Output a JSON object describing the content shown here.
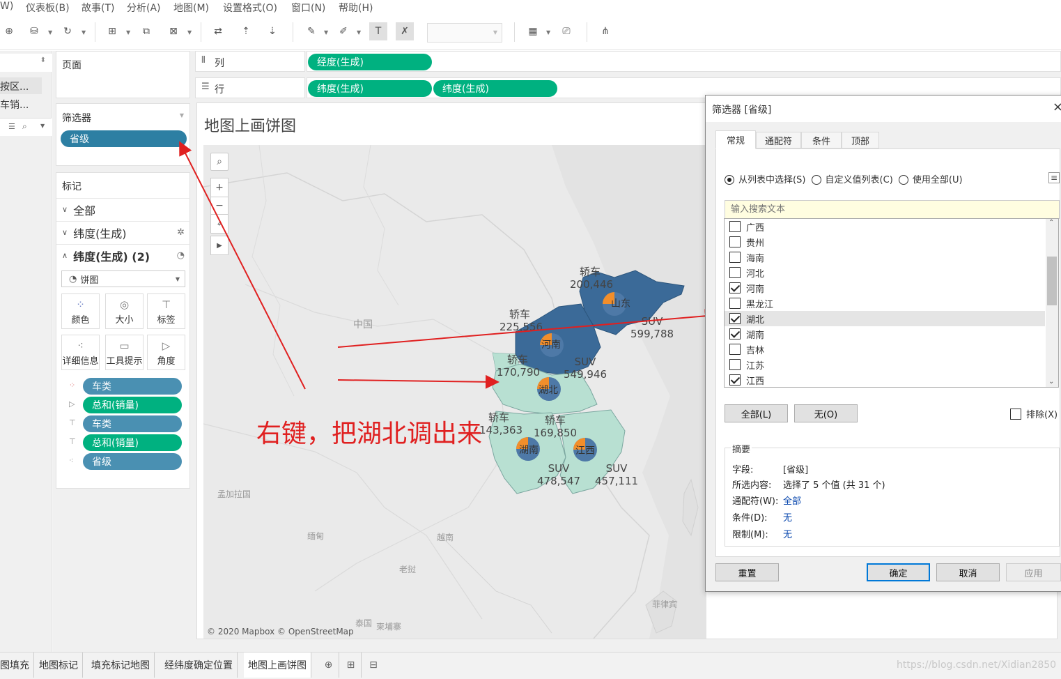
{
  "menu": [
    "W)",
    "仪表板(B)",
    "故事(T)",
    "分析(A)",
    "地图(M)",
    "设置格式(O)",
    "窗口(N)",
    "帮助(H)"
  ],
  "left_panel": {
    "items": [
      "按区...",
      "车销..."
    ]
  },
  "pages_card": {
    "title": "页面"
  },
  "filters_card": {
    "title": "筛选器",
    "pill": "省级"
  },
  "marks_card": {
    "title": "标记",
    "rows": [
      "全部",
      "纬度(生成)",
      "纬度(生成) (2)"
    ],
    "mark_type": "饼图",
    "buttons": [
      "颜色",
      "大小",
      "标签",
      "详细信息",
      "工具提示",
      "角度"
    ],
    "fields": [
      "车类",
      "总和(销量)",
      "车类",
      "总和(销量)",
      "省级"
    ]
  },
  "shelves": {
    "columns_label": "列",
    "rows_label": "行",
    "columns_pills": [
      "经度(生成)"
    ],
    "rows_pills": [
      "纬度(生成)",
      "纬度(生成)"
    ]
  },
  "viz": {
    "title": "地图上画饼图",
    "attribution": "© 2020 Mapbox © OpenStreetMap",
    "country_label": "中国",
    "faint_labels": [
      "孟加拉国",
      "缅甸",
      "老挝",
      "泰国",
      "越南",
      "菲律宾",
      "柬埔寨"
    ],
    "annotation": "右键，把湖北调出来",
    "provinces": [
      {
        "name": "山东",
        "label_top": "轿车",
        "label_top_value": "200,446",
        "label_bottom": "SUV",
        "label_bottom_value": "599,788"
      },
      {
        "name": "河南",
        "label_top": "轿车",
        "label_top_value": "225,556",
        "label_bottom": "SUV",
        "label_bottom_value": "549,946"
      },
      {
        "name": "湖北",
        "label_top": "轿车",
        "label_top_value": "170,790",
        "label_bottom": "",
        "label_bottom_value": ""
      },
      {
        "name": "湖南",
        "label_top": "轿车",
        "label_top_value": "143,363",
        "label_bottom": "SUV",
        "label_bottom_value": "478,547"
      },
      {
        "name": "江西",
        "label_top": "轿车",
        "label_top_value": "169,850",
        "label_bottom": "SUV",
        "label_bottom_value": "457,111"
      }
    ],
    "colors": {
      "pie_blue": "#4e79a7",
      "pie_orange": "#f28e2b",
      "north_fill": "#3b6a98",
      "south_fill": "#b8e0d2",
      "arrow": "#e02020"
    }
  },
  "filter_dialog": {
    "title": "筛选器 [省级]",
    "tabs": [
      "常规",
      "通配符",
      "条件",
      "顶部"
    ],
    "radios": [
      "从列表中选择(S)",
      "自定义值列表(C)",
      "使用全部(U)"
    ],
    "search_placeholder": "输入搜索文本",
    "items": [
      {
        "label": "广西",
        "checked": false
      },
      {
        "label": "贵州",
        "checked": false
      },
      {
        "label": "海南",
        "checked": false
      },
      {
        "label": "河北",
        "checked": false
      },
      {
        "label": "河南",
        "checked": true
      },
      {
        "label": "黑龙江",
        "checked": false
      },
      {
        "label": "湖北",
        "checked": true
      },
      {
        "label": "湖南",
        "checked": true
      },
      {
        "label": "吉林",
        "checked": false
      },
      {
        "label": "江苏",
        "checked": false
      },
      {
        "label": "江西",
        "checked": true
      }
    ],
    "btn_all": "全部(L)",
    "btn_none": "无(O)",
    "exclude": "排除(X)",
    "summary_title": "摘要",
    "summary": [
      {
        "k": "字段:",
        "v": "[省级]",
        "link": false
      },
      {
        "k": "所选内容:",
        "v": "选择了 5 个值 (共 31 个)",
        "link": false
      },
      {
        "k": "通配符(W):",
        "v": "全部",
        "link": true
      },
      {
        "k": "条件(D):",
        "v": "无",
        "link": true
      },
      {
        "k": "限制(M):",
        "v": "无",
        "link": true
      }
    ],
    "btn_reset": "重置",
    "btn_ok": "确定",
    "btn_cancel": "取消",
    "btn_apply": "应用"
  },
  "sheet_tabs": [
    "图填充",
    "地图标记",
    "填充标记地图",
    "经纬度确定位置",
    "地图上画饼图"
  ],
  "watermark": "https://blog.csdn.net/Xidian2850"
}
